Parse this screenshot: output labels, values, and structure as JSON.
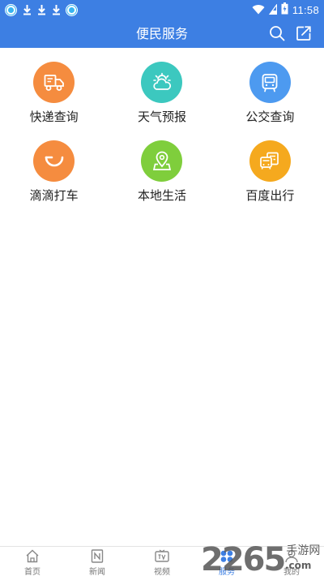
{
  "status_bar": {
    "time": "11:58",
    "left_icons": [
      "app-icon",
      "download-icon",
      "download-icon",
      "download-icon",
      "app-icon"
    ],
    "right_icons": [
      "wifi-icon",
      "signal-icon",
      "battery-icon"
    ]
  },
  "header": {
    "title": "便民服务",
    "icons": [
      "search-icon",
      "share-icon"
    ]
  },
  "services": [
    {
      "label": "快递查询",
      "icon": "delivery-truck-icon",
      "color": "#f58c3f"
    },
    {
      "label": "天气预报",
      "icon": "weather-icon",
      "color": "#3cc8bf"
    },
    {
      "label": "公交查询",
      "icon": "bus-icon",
      "color": "#4d9af0"
    },
    {
      "label": "滴滴打车",
      "icon": "didi-icon",
      "color": "#f58c3f"
    },
    {
      "label": "本地生活",
      "icon": "location-pin-icon",
      "color": "#7fce3c"
    },
    {
      "label": "百度出行",
      "icon": "travel-icon",
      "color": "#f5a91e"
    }
  ],
  "tabbar": {
    "items": [
      {
        "label": "首页",
        "icon": "home-icon"
      },
      {
        "label": "新闻",
        "icon": "news-icon"
      },
      {
        "label": "视频",
        "icon": "tv-icon"
      },
      {
        "label": "服务",
        "icon": "service-icon"
      },
      {
        "label": "我的",
        "icon": "profile-icon"
      }
    ],
    "active_index": 3
  },
  "watermark": {
    "number": "2265",
    "site": "手游网",
    "tld": ".com"
  },
  "colors": {
    "brand_blue": "#3d7fe3",
    "tab_inactive": "#777777"
  }
}
